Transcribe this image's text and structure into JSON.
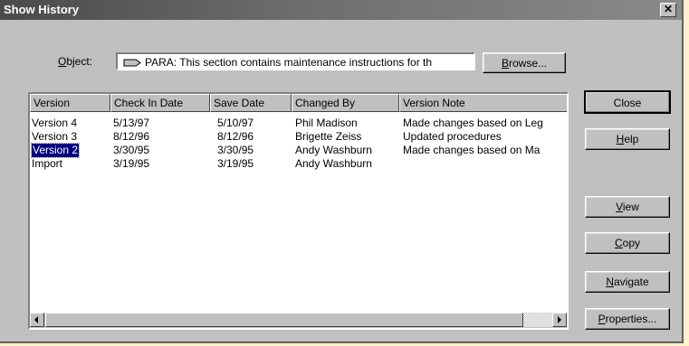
{
  "window": {
    "title": "Show History",
    "close_glyph": "✕"
  },
  "object": {
    "label": "Object:",
    "value": "PARA: This section contains maintenance instructions for th",
    "icon": "para-icon"
  },
  "buttons": {
    "browse": "Browse...",
    "close": "Close",
    "help": "Help",
    "view": "View",
    "copy": "Copy",
    "navigate": "Navigate",
    "properties": "Properties..."
  },
  "table": {
    "columns": [
      "Version",
      "Check In Date",
      "Save Date",
      "Changed  By",
      "Version Note"
    ],
    "rows": [
      [
        "Version 4",
        "5/13/97",
        "5/10/97",
        "Phil Madison",
        "Made changes based on Leg"
      ],
      [
        "Version 3",
        "8/12/96",
        "8/12/96",
        "Brigette Zeiss",
        "Updated procedures"
      ],
      [
        "Version 2",
        "3/30/95",
        "3/30/95",
        "Andy Washburn",
        "Made changes based on Ma"
      ],
      [
        "Import",
        "3/19/95",
        "3/19/95",
        "Andy Washburn",
        ""
      ]
    ],
    "selected_row": 2
  }
}
